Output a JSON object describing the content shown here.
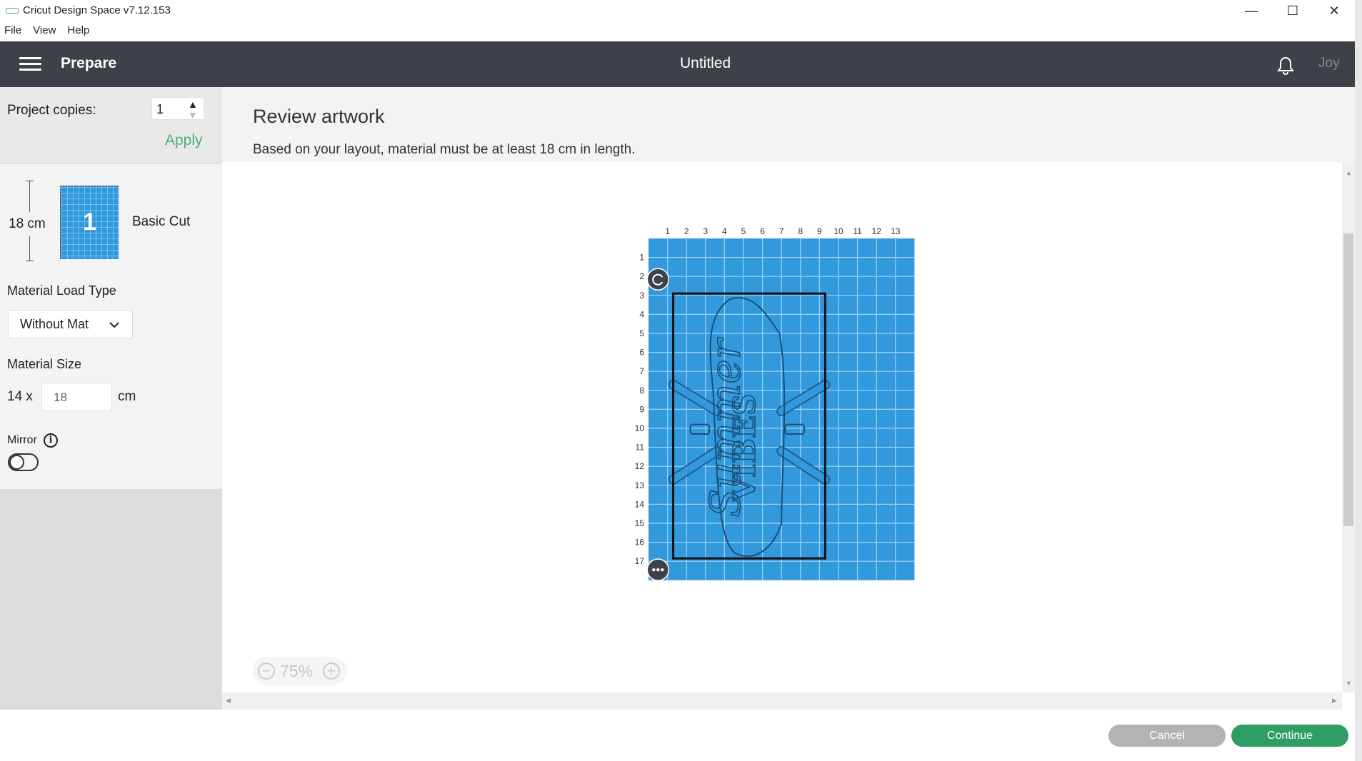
{
  "window": {
    "title": "Cricut Design Space  v7.12.153",
    "logo_text": "cricut"
  },
  "menu": [
    "File",
    "View",
    "Help"
  ],
  "header": {
    "section": "Prepare",
    "document": "Untitled",
    "user": "Joy"
  },
  "sidebar": {
    "copies_label": "Project copies:",
    "copies_value": "1",
    "apply": "Apply",
    "mat": {
      "length": "18 cm",
      "number": "1",
      "name": "Basic Cut"
    },
    "load_type_label": "Material Load Type",
    "load_type_value": "Without Mat",
    "size_label": "Material Size",
    "size_width": "14 x",
    "size_length": "18",
    "size_unit": "cm",
    "mirror_label": "Mirror",
    "mirror_on": false
  },
  "main": {
    "title": "Review artwork",
    "subtitle": "Based on your layout, material must be at least 18 cm in length.",
    "zoom": "75%"
  },
  "mat_preview": {
    "columns": [
      "1",
      "2",
      "3",
      "4",
      "5",
      "6",
      "7",
      "8",
      "9",
      "10",
      "11",
      "12",
      "13"
    ],
    "rows": [
      "1",
      "2",
      "3",
      "4",
      "5",
      "6",
      "7",
      "8",
      "9",
      "10",
      "11",
      "12",
      "13",
      "14",
      "15",
      "16",
      "17"
    ],
    "artwork_text": [
      "Summer",
      "VIBES"
    ]
  },
  "footer": {
    "cancel": "Cancel",
    "continue": "Continue"
  },
  "colors": {
    "header": "#3f4148",
    "accent": "#2e9e64",
    "mat": "#3399dd",
    "cancel": "#b3b3b3"
  }
}
